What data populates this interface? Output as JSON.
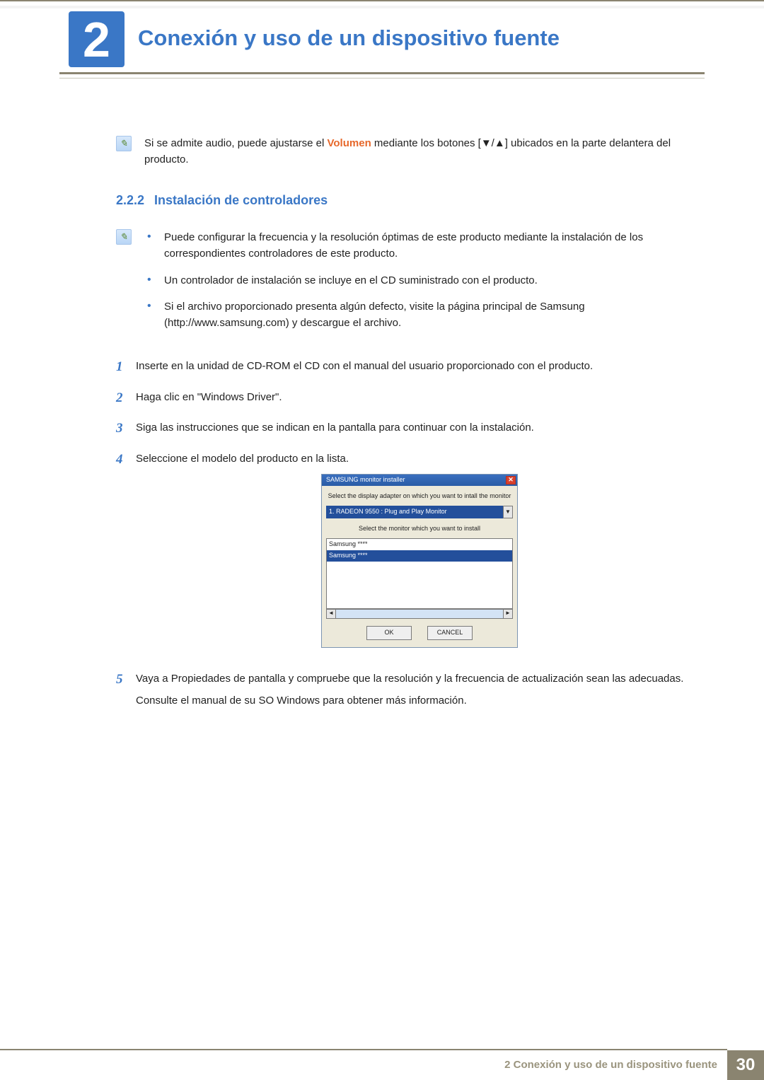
{
  "chapter": {
    "number": "2",
    "title": "Conexión y uso de un dispositivo fuente"
  },
  "audio_note": {
    "before_hl": "Si se admite audio, puede ajustarse el ",
    "highlight": "Volumen",
    "after_hl": " mediante los botones [▼/▲] ubicados en la parte delantera del producto."
  },
  "subsection": {
    "number": "2.2.2",
    "title": "Instalación de controladores"
  },
  "bullets": [
    "Puede configurar la frecuencia y la resolución óptimas de este producto mediante la instalación de los correspondientes controladores de este producto.",
    "Un controlador de instalación se incluye en el CD suministrado con el producto.",
    "Si el archivo proporcionado presenta algún defecto, visite la página principal de Samsung (http://www.samsung.com) y descargue el archivo."
  ],
  "steps": [
    {
      "n": "1",
      "text": "Inserte en la unidad de CD-ROM el CD con el manual del usuario proporcionado con el producto."
    },
    {
      "n": "2",
      "text": "Haga clic en \"Windows Driver\"."
    },
    {
      "n": "3",
      "text": "Siga las instrucciones que se indican en la pantalla para continuar con la instalación."
    },
    {
      "n": "4",
      "text": "Seleccione el modelo del producto en la lista."
    },
    {
      "n": "5",
      "text": "Vaya a Propiedades de pantalla y compruebe que la resolución y la frecuencia de actualización sean las adecuadas.",
      "extra": "Consulte el manual de su SO Windows para obtener más información."
    }
  ],
  "dialog": {
    "title": "SAMSUNG monitor installer",
    "label1": "Select the display adapter on which you want to intall the monitor",
    "adapter": "1. RADEON 9550 : Plug and Play Monitor",
    "label2": "Select the monitor which you want to install",
    "item1": "Samsung ****",
    "item2": "Samsung ****",
    "ok": "OK",
    "cancel": "CANCEL"
  },
  "footer": {
    "text": "2 Conexión y uso de un dispositivo fuente",
    "page": "30"
  }
}
